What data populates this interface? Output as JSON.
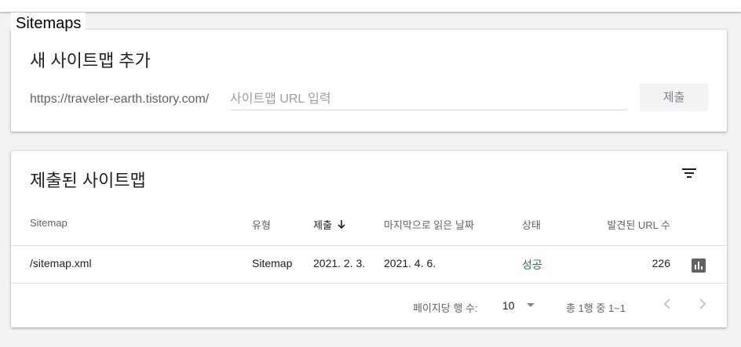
{
  "page": {
    "title": "Sitemaps"
  },
  "add_card": {
    "heading": "새 사이트맵 추가",
    "url_prefix": "https://traveler-earth.tistory.com/",
    "input_placeholder": "사이트맵 URL 입력",
    "input_value": "",
    "submit_label": "제출"
  },
  "submitted_card": {
    "heading": "제출된 사이트맵",
    "filter_icon": "filter-icon",
    "columns": {
      "sitemap": "Sitemap",
      "type": "유형",
      "submitted": "제출",
      "last_read": "마지막으로 읽은 날짜",
      "status": "상태",
      "discovered_urls": "발견된 URL 수"
    },
    "sorted_column": "submitted",
    "sort_direction": "descending",
    "rows": [
      {
        "sitemap": "/sitemap.xml",
        "type": "Sitemap",
        "submitted": "2021. 2. 3.",
        "last_read": "2021. 4. 6.",
        "status": "성공",
        "discovered_urls": "226"
      }
    ],
    "footer": {
      "rows_per_page_label": "페이지당 행 수:",
      "rows_per_page_value": "10",
      "range_text": "총 1행 중 1~1"
    }
  },
  "colors": {
    "success": "#188038",
    "text_secondary": "#5f6368",
    "icon": "#5f6368",
    "background": "#f1f3f4"
  }
}
